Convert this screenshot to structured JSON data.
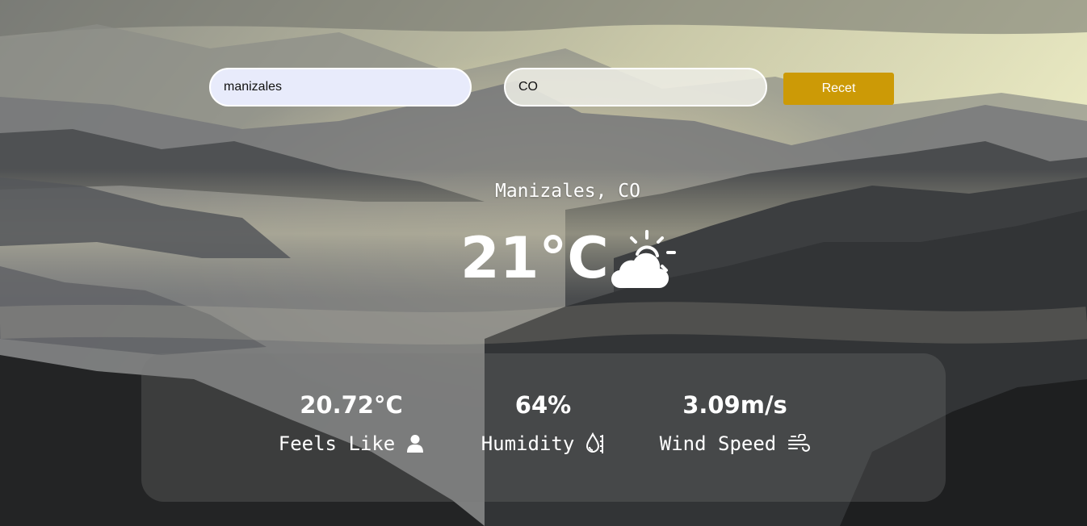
{
  "search": {
    "city_value": "manizales",
    "country_value": "CO",
    "reset_label": "Recet"
  },
  "weather": {
    "location": "Manizales, CO",
    "temperature": "21°C",
    "condition_icon": "partly-cloudy-day-icon"
  },
  "stats": {
    "feels_like": {
      "value": "20.72°C",
      "label": "Feels Like",
      "icon": "person-icon"
    },
    "humidity": {
      "value": "64%",
      "label": "Humidity",
      "icon": "humidity-drop-icon"
    },
    "wind": {
      "value": "3.09m/s",
      "label": "Wind Speed",
      "icon": "wind-icon"
    }
  },
  "colors": {
    "reset_button": "#cc9a06",
    "city_field_bg": "#e8ebfb",
    "text": "#ffffff"
  }
}
